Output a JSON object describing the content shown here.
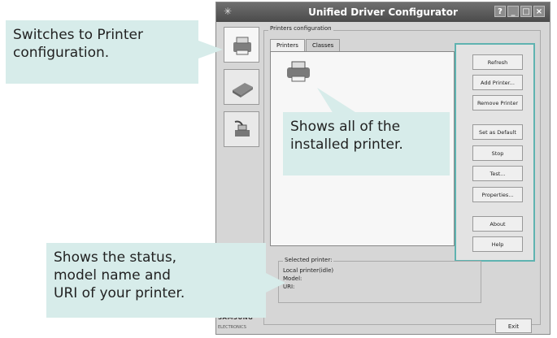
{
  "window": {
    "title": "Unified Driver Configurator",
    "controls": [
      "?",
      "_",
      "□",
      "×"
    ]
  },
  "left_tools": [
    {
      "name": "printer-config",
      "icon": "printer-icon"
    },
    {
      "name": "scanner-config",
      "icon": "scanner-icon"
    },
    {
      "name": "port-config",
      "icon": "port-icon"
    }
  ],
  "printers_configuration": {
    "group_label": "Printers configuration",
    "tabs": [
      "Printers",
      "Classes"
    ]
  },
  "buttons": {
    "refresh": "Refresh",
    "add_printer": "Add Printer...",
    "remove_printer": "Remove Printer",
    "set_default": "Set as Default",
    "stop": "Stop",
    "test": "Test...",
    "properties": "Properties...",
    "about": "About",
    "help": "Help"
  },
  "selected_printer": {
    "title": "Selected printer:",
    "line1": "Local printer(idle)",
    "line2": "Model:",
    "line3": "URI:"
  },
  "footer": {
    "logo": "SAMSUNG",
    "logo_sub": "ELECTRONICS",
    "exit": "Exit"
  },
  "callouts": {
    "printer_config_1": "Switches to Printer",
    "printer_config_2": "configuration.",
    "installed_1": "Shows all of the",
    "installed_2": "installed printer.",
    "status_1": "Shows the status,",
    "status_2": "model name and",
    "status_3": "URI of your printer."
  },
  "colors": {
    "callout_bg": "#d7ecea",
    "accent_border": "#5fb3b0"
  }
}
